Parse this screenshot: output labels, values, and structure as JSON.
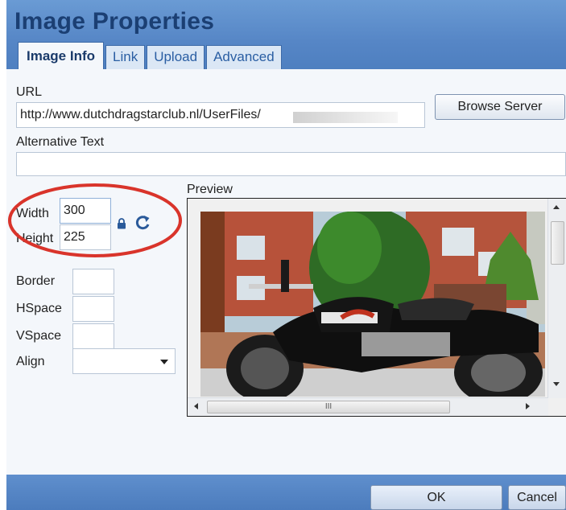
{
  "dialog": {
    "title": "Image Properties",
    "tabs": [
      {
        "label": "Image Info",
        "active": true
      },
      {
        "label": "Link",
        "active": false
      },
      {
        "label": "Upload",
        "active": false
      },
      {
        "label": "Advanced",
        "active": false
      }
    ]
  },
  "fields": {
    "url_label": "URL",
    "url_value": "http://www.dutchdragstarclub.nl/UserFiles/",
    "browse_label": "Browse Server",
    "alt_label": "Alternative Text",
    "alt_value": "",
    "width_label": "Width",
    "width_value": "300",
    "height_label": "Height",
    "height_value": "225",
    "border_label": "Border",
    "border_value": "",
    "hspace_label": "HSpace",
    "hspace_value": "",
    "vspace_label": "VSpace",
    "vspace_value": "",
    "align_label": "Align",
    "align_value": ""
  },
  "preview": {
    "label": "Preview",
    "hscroll_grip": "III"
  },
  "footer": {
    "ok_label": "OK",
    "cancel_label": "Cancel"
  },
  "icons": {
    "lock": "lock-icon",
    "reset": "reset-size-icon"
  },
  "colors": {
    "accent": "#5686c6",
    "title_text": "#1b3f73",
    "highlight_circle": "#d9342b"
  }
}
